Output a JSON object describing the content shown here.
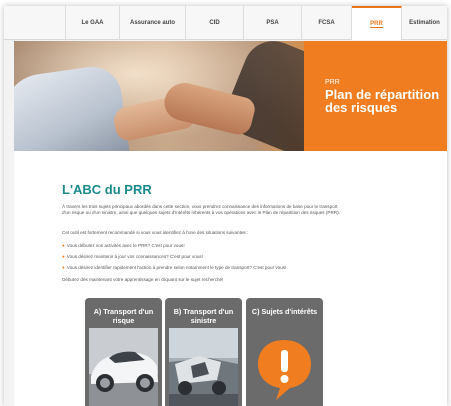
{
  "nav": {
    "items": [
      {
        "label": "Le GAA"
      },
      {
        "label": "Assurance auto"
      },
      {
        "label": "CID"
      },
      {
        "label": "PSA"
      },
      {
        "label": "FCSA"
      },
      {
        "label": "PRR",
        "active": true
      },
      {
        "label": "Estimation"
      }
    ]
  },
  "hero": {
    "small": "PRR",
    "title": "Plan de répartition des risques"
  },
  "main": {
    "title": "L'ABC du PRR",
    "paragraphs": [
      "À travers les trois sujets principaux abordés dans cette section, vous prendrez connaissance des informations de base pour le transport d'un risque ou d'un sinistre, ainsi que quelques sujets d'intérêts inhérents à vos opérations avec le Plan de répartition des risques (PRR).",
      "Cet outil est fortement recommandé si vous vous identifiez à l'une des situations suivantes :"
    ],
    "bullets": [
      "Vous débutez vos activités avec le PRR? C'est pour vous!",
      "Vous désirez maintenir à jour vos connaissances? C'est pour vous!",
      "Vous désirez identifier rapidement l'action à prendre selon notamment le type de transport? C'est pour vous!"
    ],
    "closing": "Débutez dès maintenant votre apprentissage en cliquant sur le sujet recherché!"
  },
  "cards": [
    {
      "title": "A) Transport d'un risque"
    },
    {
      "title": "B) Transport d'un sinistre"
    },
    {
      "title": "C) Sujets d'intérêts"
    }
  ],
  "colors": {
    "accent": "#f07d1f",
    "teal": "#1c8a8a",
    "card": "#6b6b6b"
  }
}
